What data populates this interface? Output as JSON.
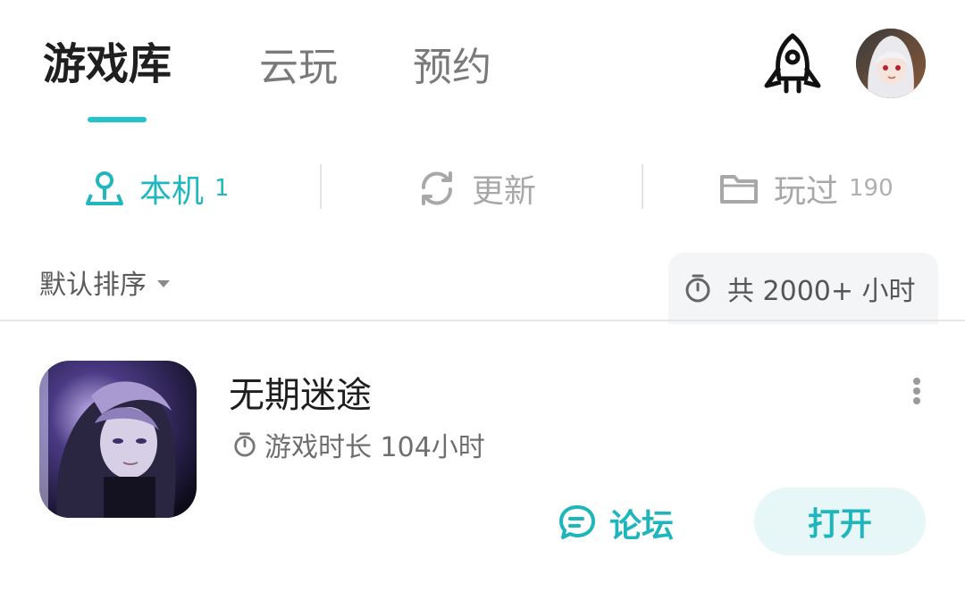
{
  "top_tabs": [
    {
      "label": "游戏库",
      "active": true
    },
    {
      "label": "云玩",
      "active": false
    },
    {
      "label": "预约",
      "active": false
    }
  ],
  "header_icons": {
    "rocket": "rocket-icon",
    "avatar": "user-avatar"
  },
  "filters": [
    {
      "label": "本机",
      "count": "1",
      "icon": "location-person-icon",
      "active": true
    },
    {
      "label": "更新",
      "count": "",
      "icon": "refresh-icon",
      "active": false
    },
    {
      "label": "玩过",
      "count": "190",
      "icon": "folder-icon",
      "active": false
    }
  ],
  "sort": {
    "label": "默认排序",
    "icon": "caret-down-icon"
  },
  "total_playtime": {
    "text": "共 2000+ 小时",
    "icon": "stopwatch-icon"
  },
  "games": [
    {
      "title": "无期迷途",
      "playtime": "游戏时长 104小时",
      "forum_label": "论坛",
      "open_label": "打开"
    }
  ],
  "colors": {
    "accent": "#22c3c9",
    "accent_text": "#1fb5bc",
    "open_bg": "#e7f6f7",
    "chip_bg": "#f3f5f6"
  }
}
